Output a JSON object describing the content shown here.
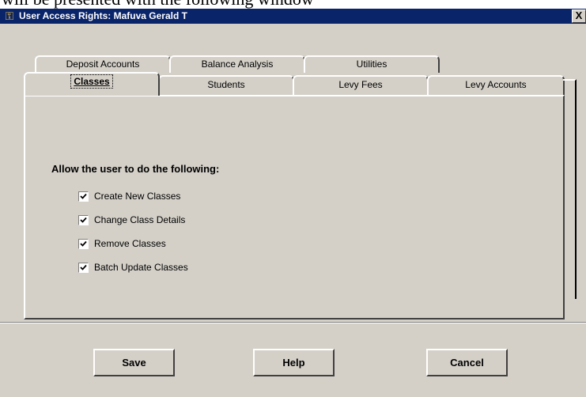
{
  "document": {
    "caption": "will be presented with the following window"
  },
  "window": {
    "title": "User Access Rights: Mafuva Gerald T",
    "close_label": "X"
  },
  "tabs_back": [
    {
      "label": "Deposit Accounts"
    },
    {
      "label": "Balance Analysis"
    },
    {
      "label": "Utilities"
    }
  ],
  "tabs_front": [
    {
      "label": "Classes",
      "active": true
    },
    {
      "label": "Students"
    },
    {
      "label": "Levy Fees"
    },
    {
      "label": "Levy Accounts"
    }
  ],
  "panel": {
    "heading": "Allow the user to do the following:",
    "permissions": [
      {
        "label": "Create New Classes",
        "checked": true
      },
      {
        "label": "Change Class Details",
        "checked": true
      },
      {
        "label": "Remove Classes",
        "checked": true
      },
      {
        "label": "Batch Update Classes",
        "checked": true
      }
    ]
  },
  "buttons": {
    "save": "Save",
    "help": "Help",
    "cancel": "Cancel"
  }
}
